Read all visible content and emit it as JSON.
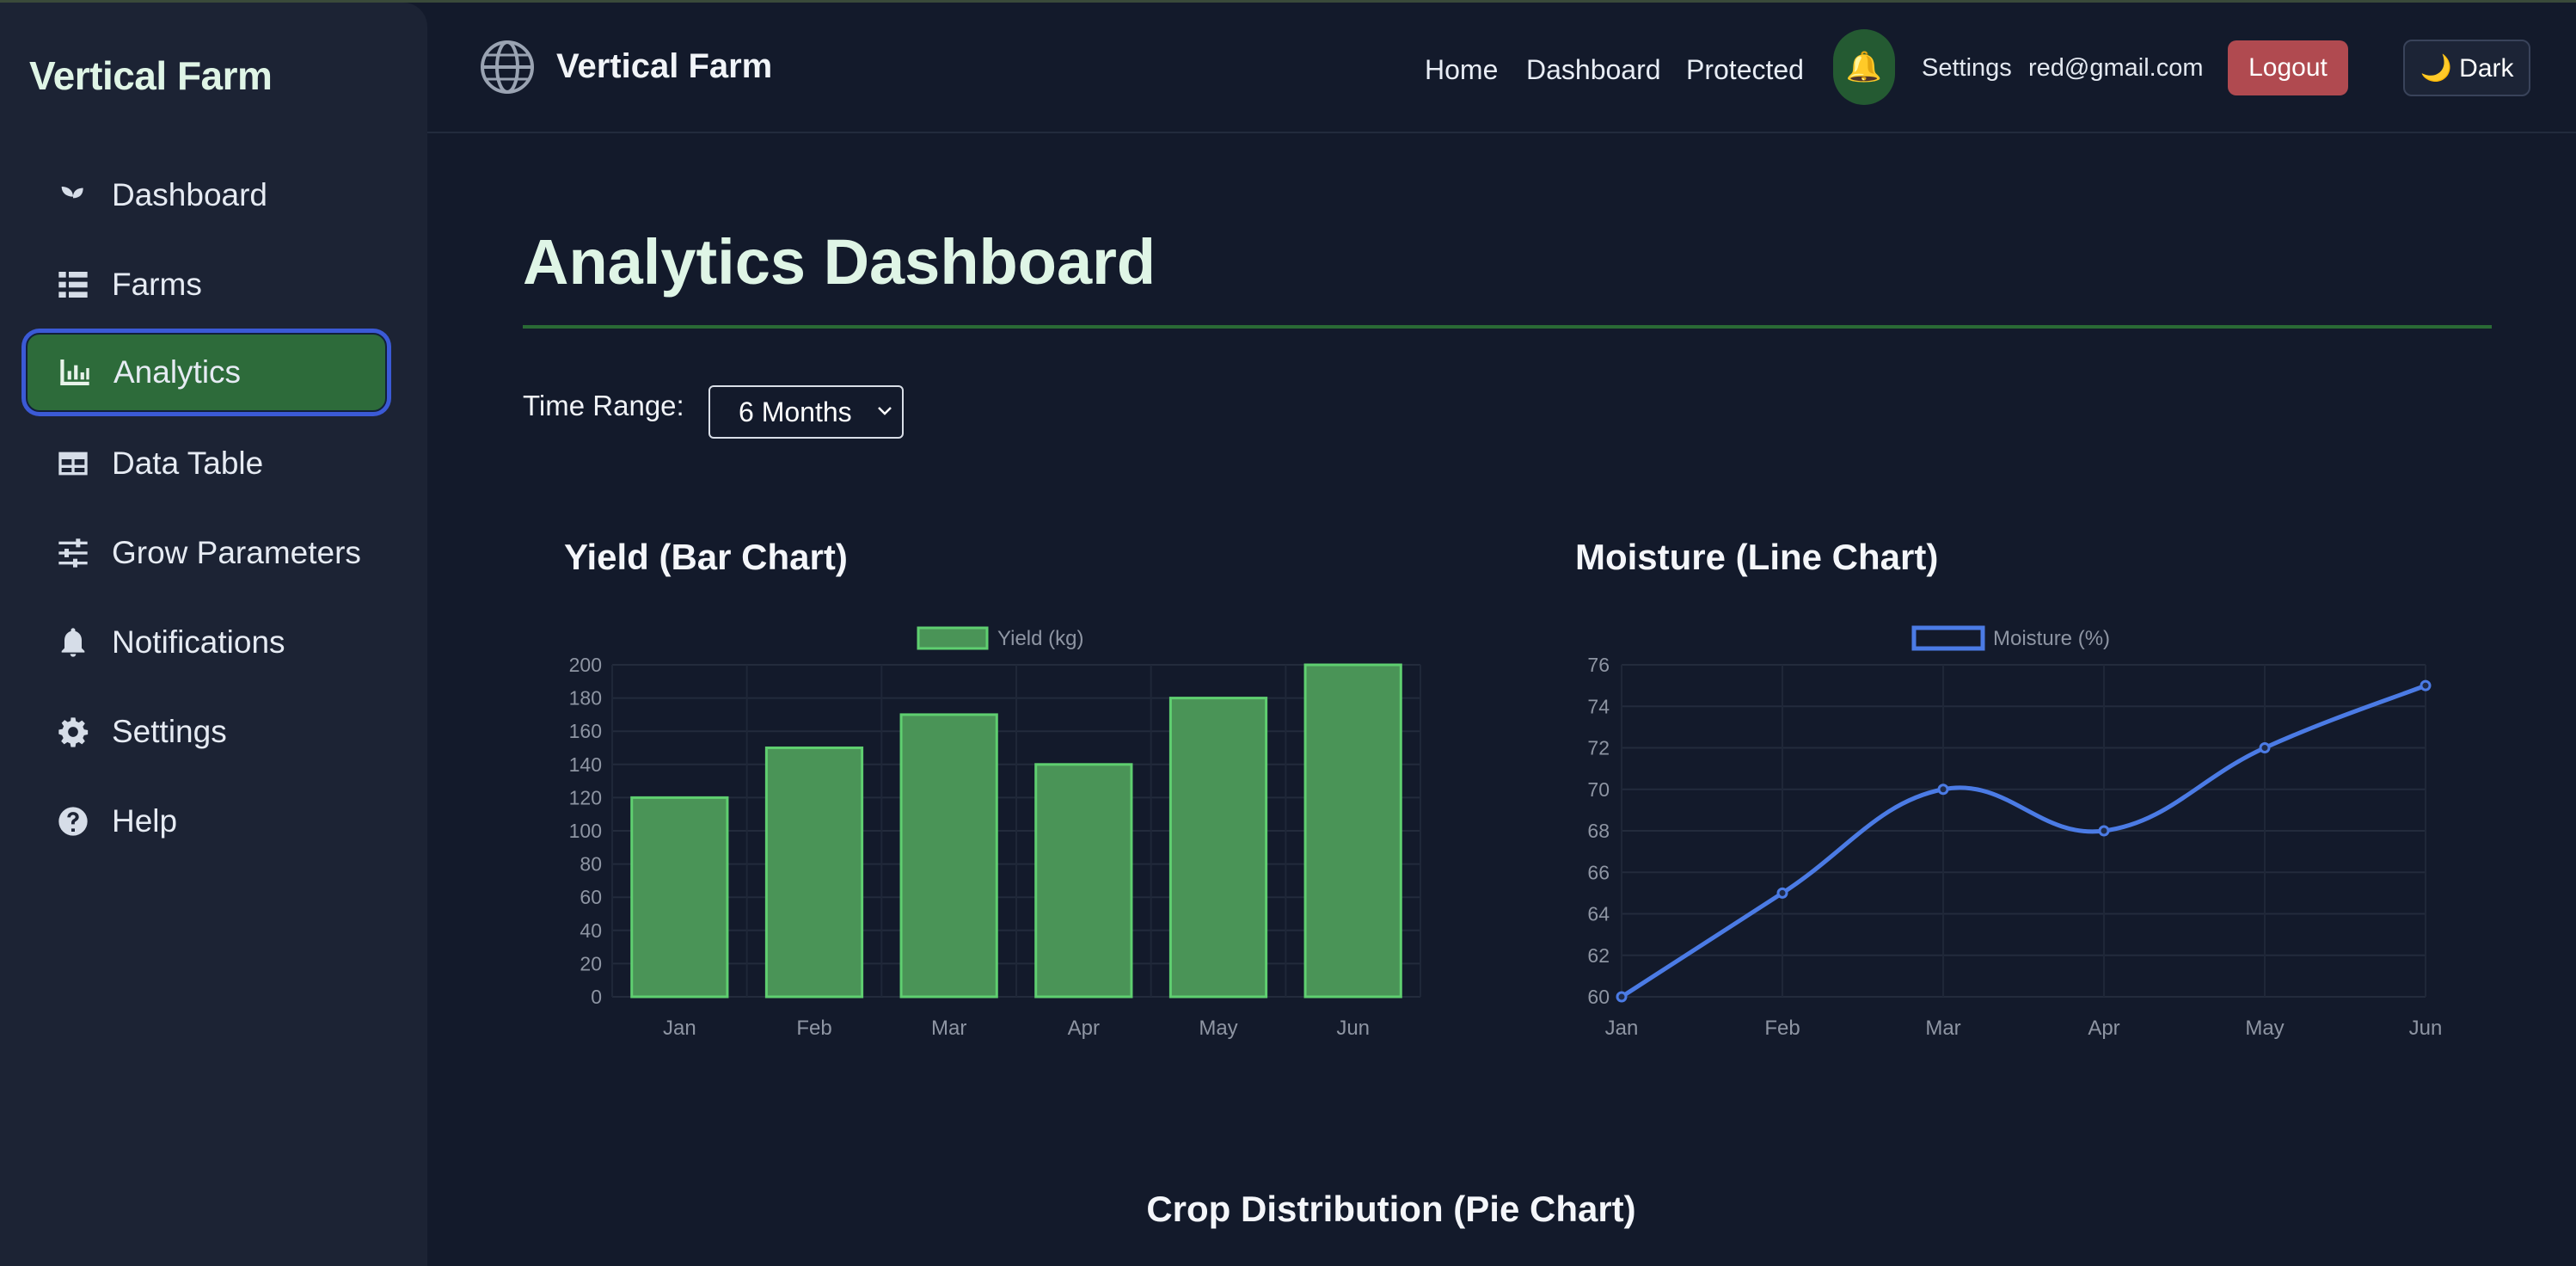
{
  "sidebar": {
    "brand": "Vertical Farm",
    "items": [
      {
        "label": "Dashboard",
        "icon": "seedling-icon"
      },
      {
        "label": "Farms",
        "icon": "list-icon"
      },
      {
        "label": "Analytics",
        "icon": "bar-chart-icon",
        "active": true
      },
      {
        "label": "Data Table",
        "icon": "table-icon"
      },
      {
        "label": "Grow Parameters",
        "icon": "sliders-icon"
      },
      {
        "label": "Notifications",
        "icon": "bell-icon"
      },
      {
        "label": "Settings",
        "icon": "gear-icon"
      },
      {
        "label": "Help",
        "icon": "question-circle-icon"
      }
    ]
  },
  "header": {
    "app_title": "Vertical Farm",
    "links": [
      "Home",
      "Dashboard",
      "Protected"
    ],
    "notification_icon": "bell-icon",
    "settings_label": "Settings",
    "user_email": "red@gmail.com",
    "logout_label": "Logout",
    "theme_toggle_label": "🌙 Dark"
  },
  "main": {
    "title": "Analytics Dashboard",
    "time_range_label": "Time Range:",
    "time_range_value": "6 Months",
    "pie_title": "Crop Distribution (Pie Chart)"
  },
  "colors": {
    "accent_green": "#2d6b3a",
    "bar_fill": "#4a9457",
    "bar_border": "#5fcf70",
    "line_color": "#4b7be5",
    "logout": "#b04a50"
  },
  "chart_data": [
    {
      "type": "bar",
      "title": "Yield (Bar Chart)",
      "categories": [
        "Jan",
        "Feb",
        "Mar",
        "Apr",
        "May",
        "Jun"
      ],
      "series": [
        {
          "name": "Yield (kg)",
          "values": [
            120,
            150,
            170,
            140,
            180,
            200
          ]
        }
      ],
      "ylim": [
        0,
        200
      ],
      "yticks": [
        0,
        20,
        40,
        60,
        80,
        100,
        120,
        140,
        160,
        180,
        200
      ],
      "legend": "top-center",
      "grid": true
    },
    {
      "type": "line",
      "title": "Moisture (Line Chart)",
      "categories": [
        "Jan",
        "Feb",
        "Mar",
        "Apr",
        "May",
        "Jun"
      ],
      "series": [
        {
          "name": "Moisture (%)",
          "values": [
            60,
            65,
            70,
            68,
            72,
            75
          ]
        }
      ],
      "ylim": [
        60,
        76
      ],
      "yticks": [
        60,
        62,
        64,
        66,
        68,
        70,
        72,
        74,
        76
      ],
      "legend": "top-center",
      "grid": true
    }
  ]
}
